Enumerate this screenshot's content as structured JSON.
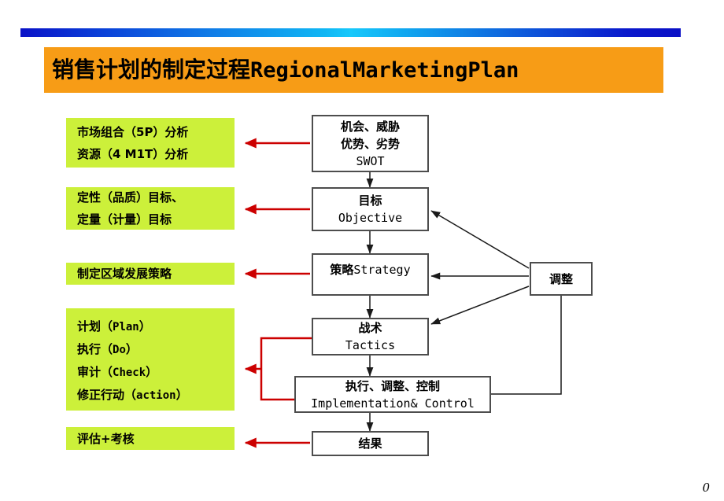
{
  "slide": {
    "page_number": "0",
    "title": {
      "chinese": "销售计划的制定过程",
      "latin": "RegionalMarketingPlan",
      "bar_color": "#f79c16"
    },
    "accent_bar": {
      "start_color": "#0a12c8",
      "mid_color": "#17c8fb",
      "end_color": "#0a10c6"
    }
  },
  "left_boxes": [
    {
      "name": "market-mix-analysis",
      "fill": "#ccf03a",
      "lines": [
        {
          "pre": "市场组合（5P）分析",
          "mono": "",
          "post": ""
        },
        {
          "pre": "资源（4 M1T）分析",
          "mono": "",
          "post": ""
        }
      ]
    },
    {
      "name": "objectives-qualitative-quantitative",
      "fill": "#ccf03a",
      "lines": [
        {
          "pre": "定性（品质）目标、",
          "mono": "",
          "post": ""
        },
        {
          "pre": "定量（计量）目标",
          "mono": "",
          "post": ""
        }
      ]
    },
    {
      "name": "regional-development-strategy",
      "fill": "#ccf03a",
      "lines": [
        {
          "pre": "制定区域发展策略",
          "mono": "",
          "post": ""
        }
      ]
    },
    {
      "name": "pdca-cycle",
      "fill": "#ccf03a",
      "lines": [
        {
          "pre": "计划（",
          "mono": "Plan",
          "post": "）"
        },
        {
          "pre": "执行（",
          "mono": "Do",
          "post": "）"
        },
        {
          "pre": "审计（",
          "mono": "Check",
          "post": "）"
        },
        {
          "pre": "修正行动（",
          "mono": "action",
          "post": "）"
        }
      ]
    },
    {
      "name": "evaluation-assessment",
      "fill": "#ccf03a",
      "lines": [
        {
          "pre": "评估+考核",
          "mono": "",
          "post": ""
        }
      ]
    }
  ],
  "flow_boxes": [
    {
      "name": "swot-box",
      "cn1": "机会、威胁",
      "cn2": "优势、劣势",
      "en": "SWOT"
    },
    {
      "name": "objective-box",
      "cn1": "目标",
      "en": "Objective"
    },
    {
      "name": "strategy-box",
      "mix_cn": "策略",
      "mix_en": "Strategy"
    },
    {
      "name": "tactics-box",
      "cn1": "战术",
      "en": "Tactics"
    },
    {
      "name": "implementation-control-box",
      "cn1": "执行、调整、控制",
      "en": "Implementation& Control"
    },
    {
      "name": "result-box",
      "cn1": "结果"
    },
    {
      "name": "adjust-box",
      "cn1": "调整"
    }
  ],
  "connectors": {
    "black_color": "#1a1a1a",
    "red_color": "#cc0000",
    "red_arrow_count": 5,
    "feedback_targets": [
      "objective-box",
      "strategy-box",
      "tactics-box"
    ]
  }
}
